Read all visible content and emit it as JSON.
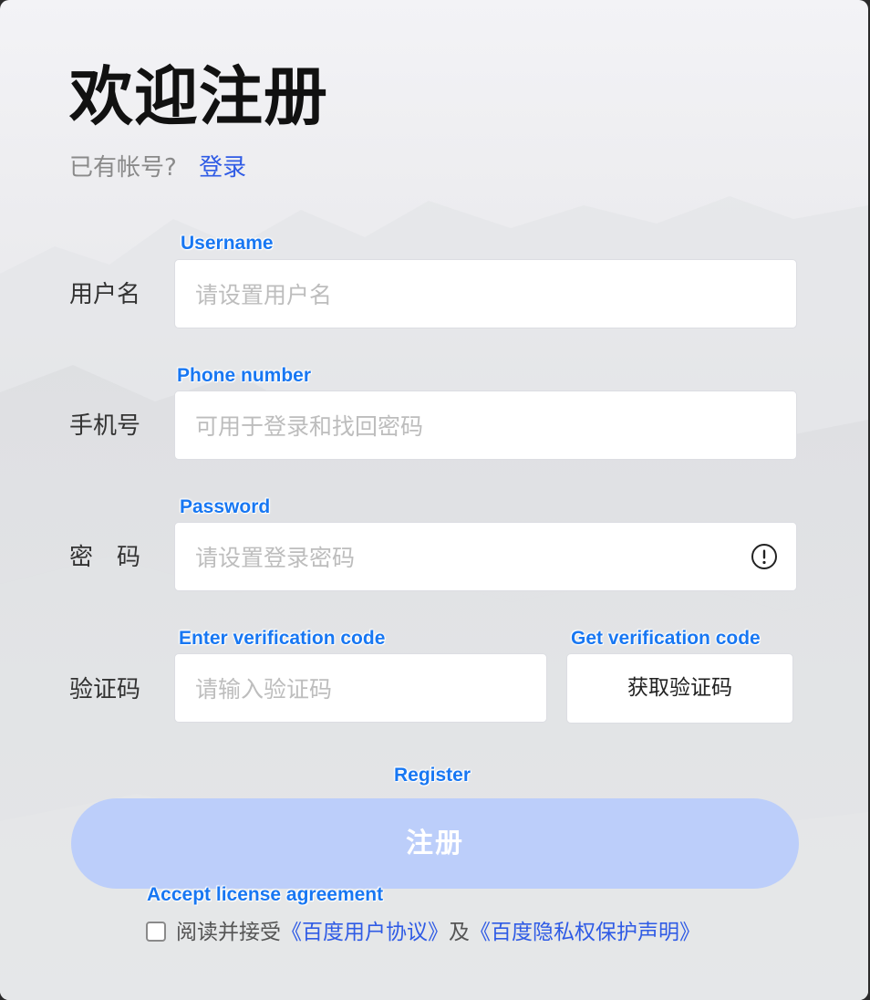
{
  "header": {
    "title": "欢迎注册",
    "have_account": "已有帐号?",
    "login_link": "登录"
  },
  "annotations": {
    "username": "Username",
    "phone": "Phone number",
    "password": "Password",
    "code_input": "Enter verification code",
    "code_button": "Get verification code",
    "register": "Register",
    "agreement": "Accept license agreement"
  },
  "form": {
    "username": {
      "label": "用户名",
      "placeholder": "请设置用户名",
      "value": ""
    },
    "phone": {
      "label": "手机号",
      "placeholder": "可用于登录和找回密码",
      "value": ""
    },
    "password": {
      "label": "密　码",
      "placeholder": "请设置登录密码",
      "value": ""
    },
    "code": {
      "label": "验证码",
      "placeholder": "请输入验证码",
      "value": ""
    },
    "code_button": "获取验证码",
    "register_button": "注册"
  },
  "agreement": {
    "checked": false,
    "prefix": "阅读并接受",
    "link1": "《百度用户协议》",
    "and": "及",
    "link2": "《百度隐私权保护声明》"
  },
  "icons": {
    "password_hint": "info-circle-icon"
  },
  "colors": {
    "link": "#2f5be5",
    "annotation": "#1877f2",
    "register_button": "#bccefa"
  }
}
